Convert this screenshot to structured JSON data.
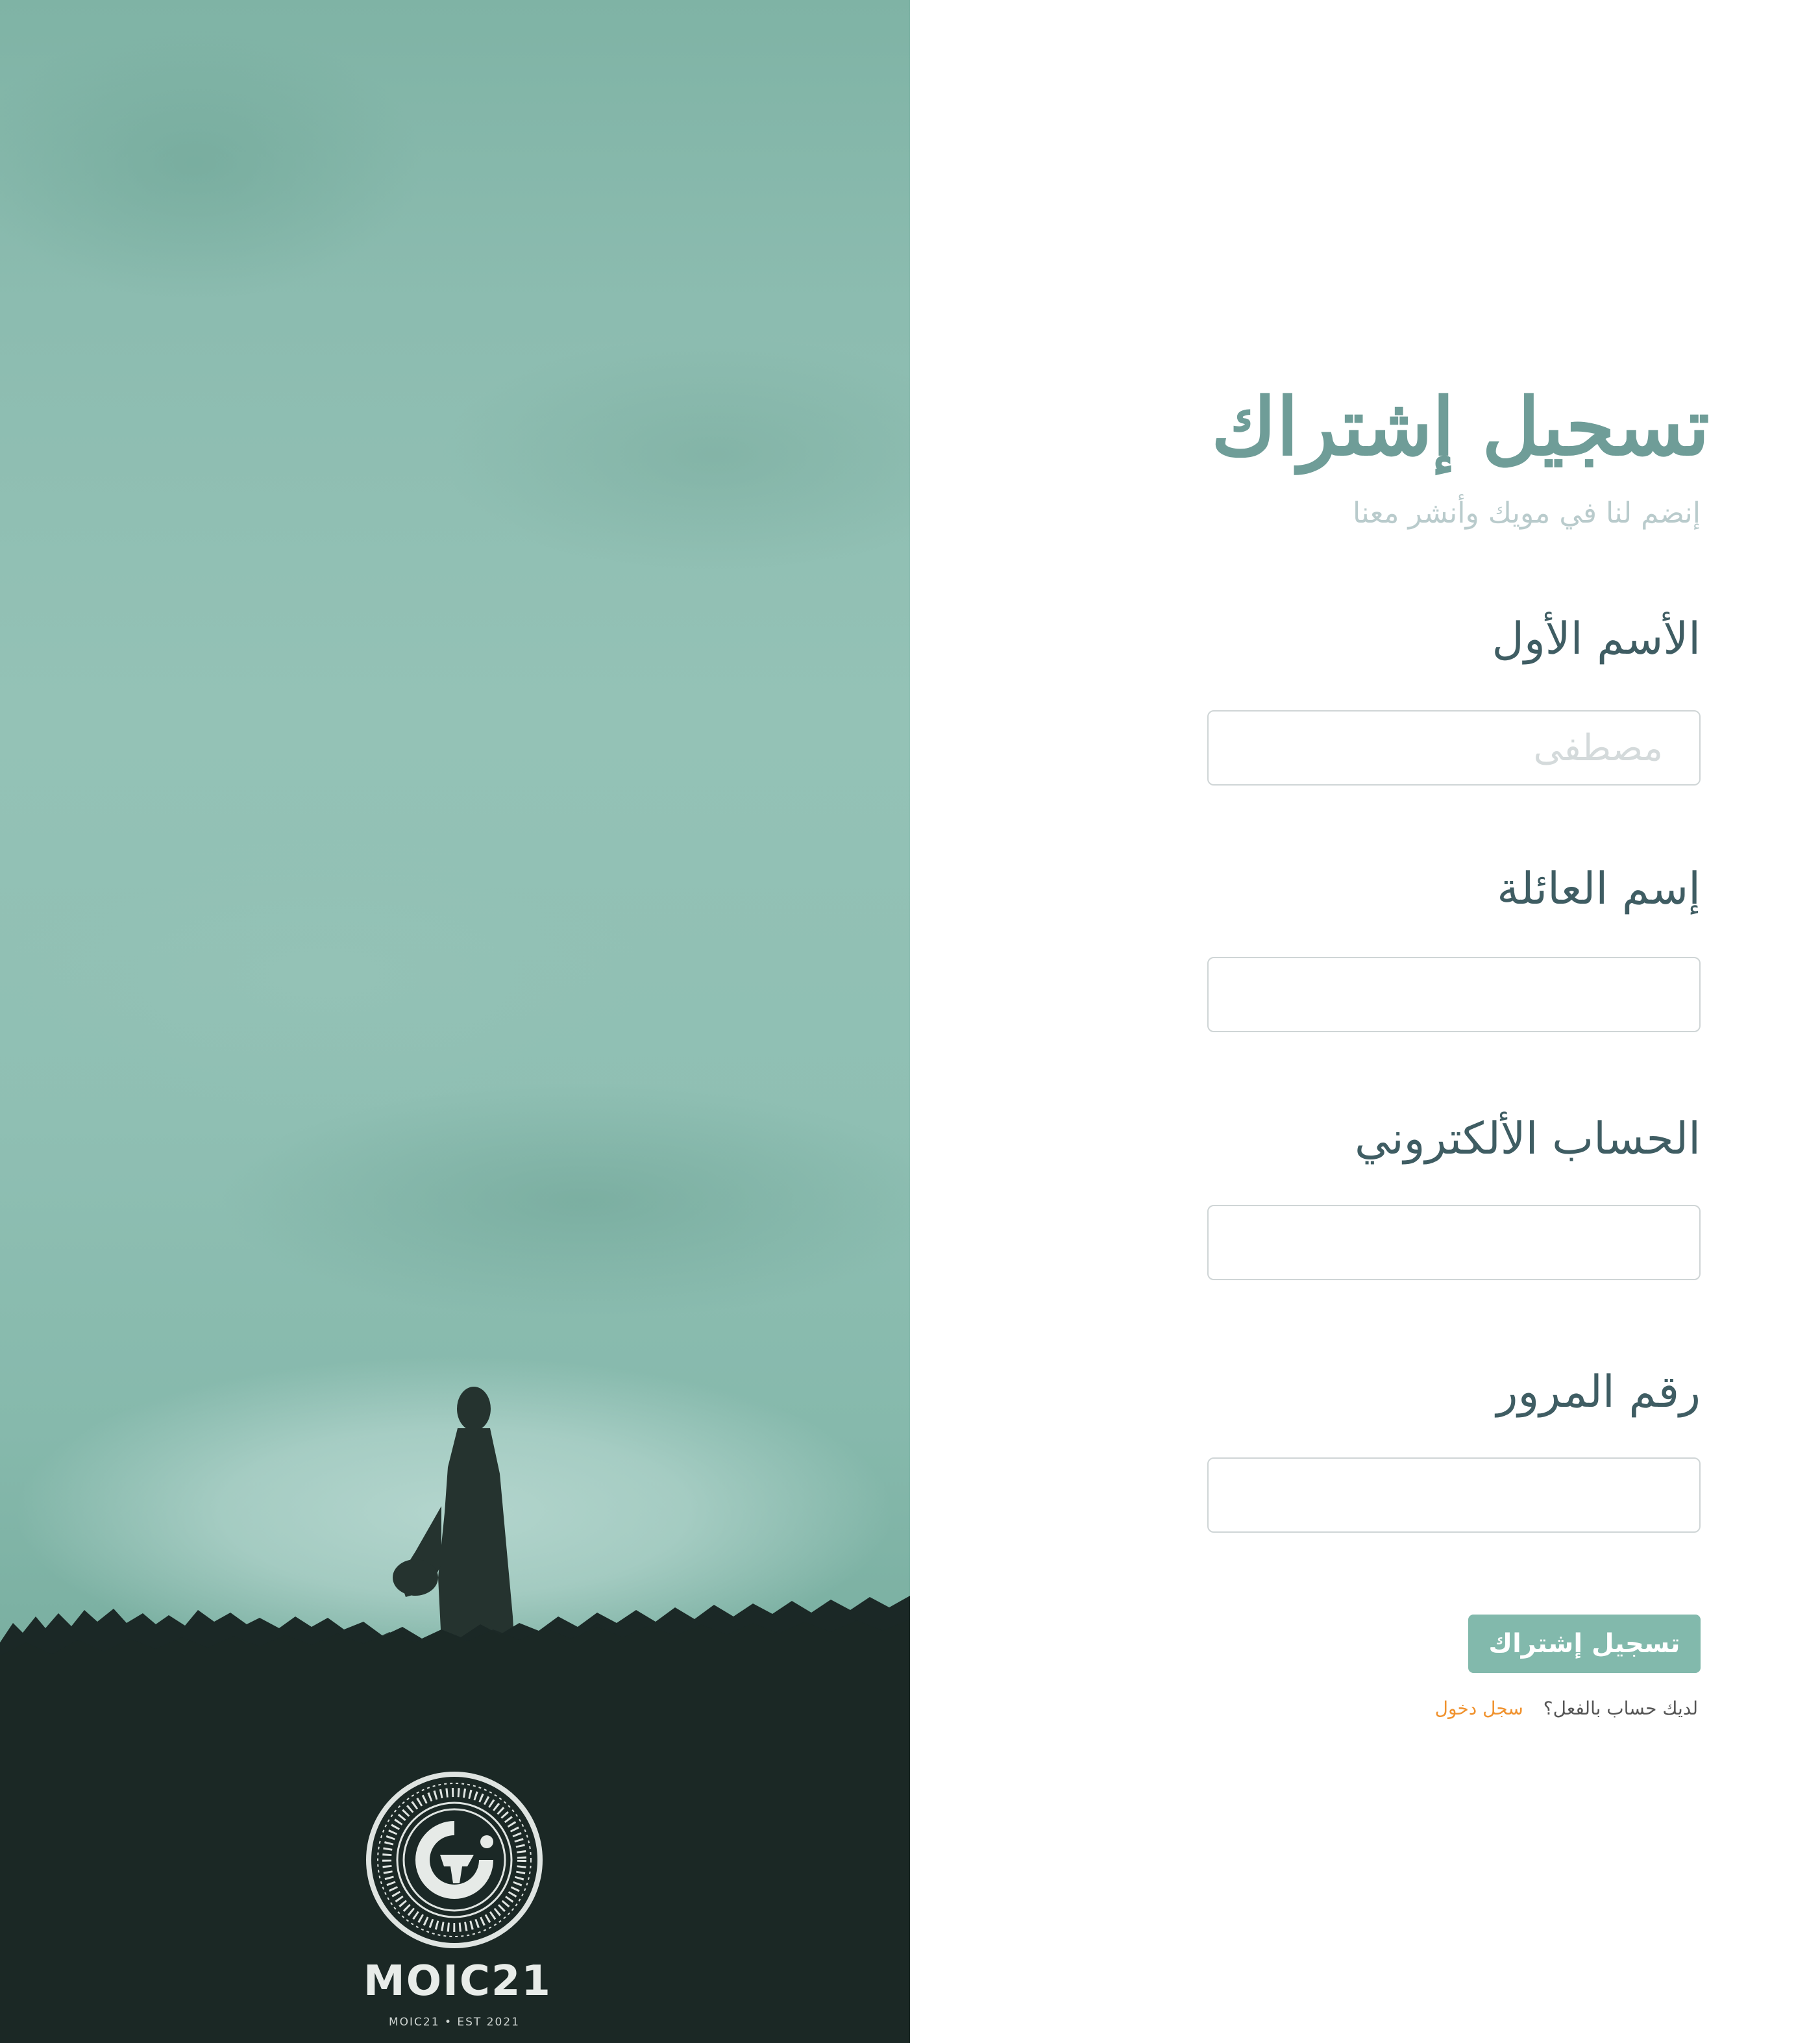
{
  "hero": {
    "logo_text": "MOIC21",
    "logo_subtext": "MOIC21 • EST 2021",
    "colors": {
      "sky": "#8fbfb3",
      "ground": "#1b2826"
    }
  },
  "form": {
    "title": "تسجيل إشتراك",
    "subtitle": "إنضم لنا في مويك وأنشر معنا",
    "fields": [
      {
        "label": "الأسم الأول",
        "placeholder": "مصطفى",
        "value": ""
      },
      {
        "label": "إسم العائلة",
        "placeholder": "",
        "value": ""
      },
      {
        "label": "الحساب الألكتروني",
        "placeholder": "",
        "value": ""
      },
      {
        "label": "رقم المرور",
        "placeholder": "",
        "value": ""
      }
    ],
    "submit_label": "تسجيل إشتراك",
    "login_prompt": "لديك حساب بالفعل؟",
    "login_link": "سجل دخول",
    "colors": {
      "accent": "#82b9ac",
      "title": "#6f9d98",
      "link": "#f0922e"
    }
  }
}
